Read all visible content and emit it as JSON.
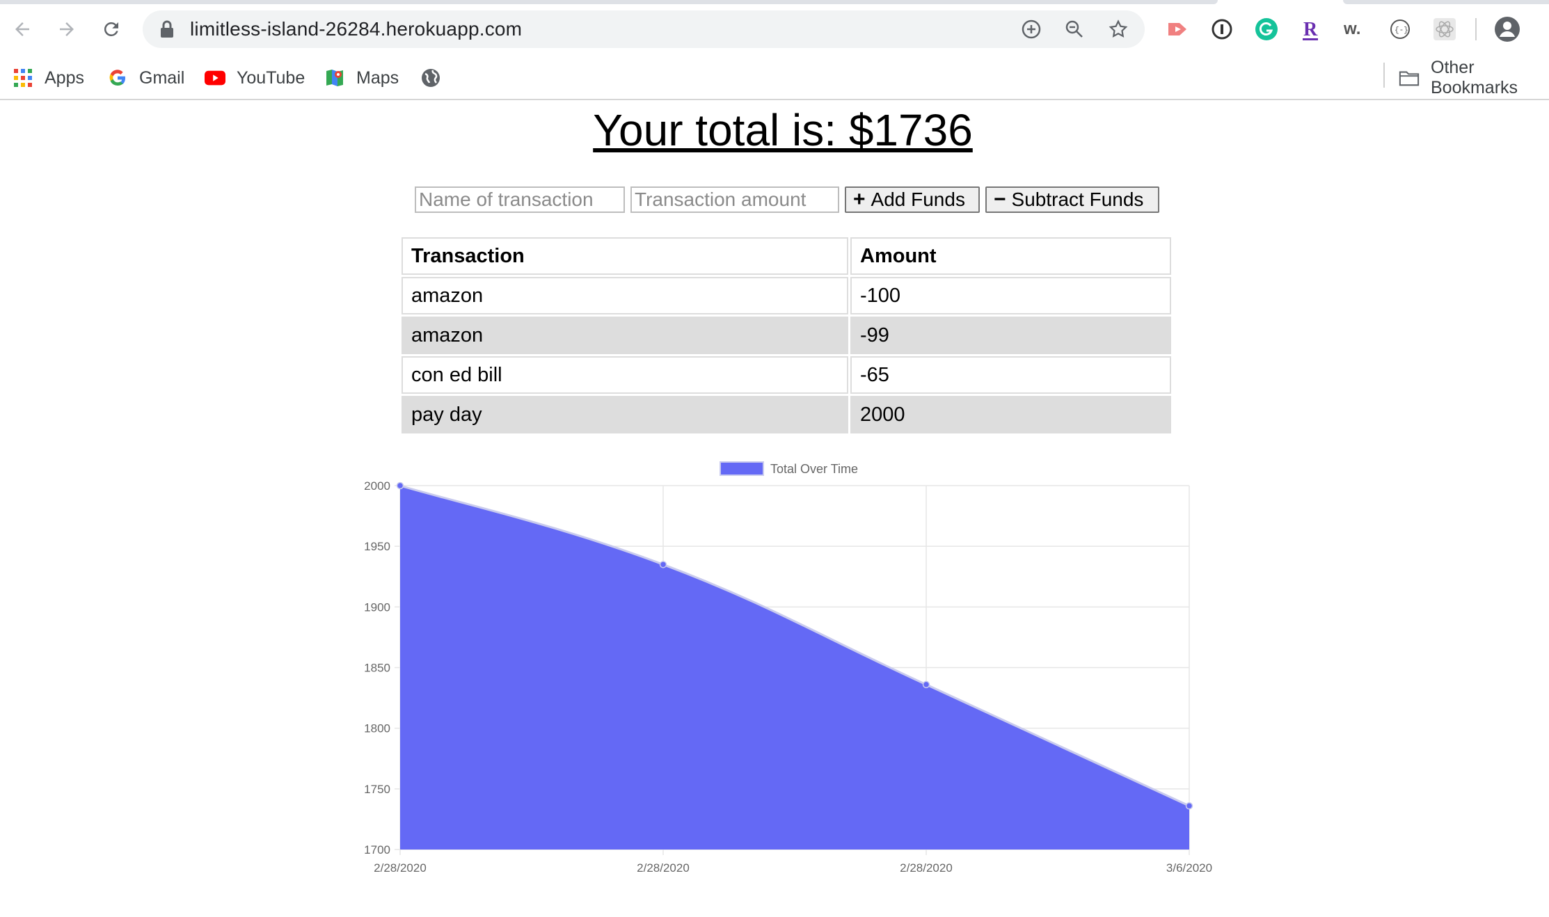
{
  "browser": {
    "url": "limitless-island-26284.herokuapp.com",
    "bookmarks": [
      {
        "label": "Apps",
        "icon": "apps-grid-icon"
      },
      {
        "label": "Gmail",
        "icon": "google-g-icon"
      },
      {
        "label": "YouTube",
        "icon": "youtube-icon"
      },
      {
        "label": "Maps",
        "icon": "maps-icon"
      },
      {
        "label": "",
        "icon": "globe-icon"
      }
    ],
    "other_bookmarks": "Other Bookmarks"
  },
  "header": {
    "title": "Your total is: $1736"
  },
  "form": {
    "name_placeholder": "Name of transaction",
    "amount_placeholder": "Transaction amount",
    "add_label": "Add Funds",
    "subtract_label": "Subtract Funds"
  },
  "table": {
    "headers": [
      "Transaction",
      "Amount"
    ],
    "rows": [
      {
        "name": "amazon",
        "amount": "-100"
      },
      {
        "name": "amazon",
        "amount": "-99"
      },
      {
        "name": "con ed bill",
        "amount": "-65"
      },
      {
        "name": "pay day",
        "amount": "2000"
      }
    ]
  },
  "colors": {
    "area_fill": "#6469f5",
    "area_line": "#c9cbee",
    "grid": "#e6e6e6"
  },
  "chart_data": {
    "type": "area",
    "legend": [
      "Total Over Time"
    ],
    "legend_position": "top-center",
    "categories": [
      "2/28/2020",
      "2/28/2020",
      "2/28/2020",
      "3/6/2020"
    ],
    "series": [
      {
        "name": "Total Over Time",
        "values": [
          2000,
          1935,
          1836,
          1736
        ]
      }
    ],
    "ylim": [
      1700,
      2000
    ],
    "yticks": [
      1700,
      1750,
      1800,
      1850,
      1900,
      1950,
      2000
    ],
    "grid": true
  }
}
